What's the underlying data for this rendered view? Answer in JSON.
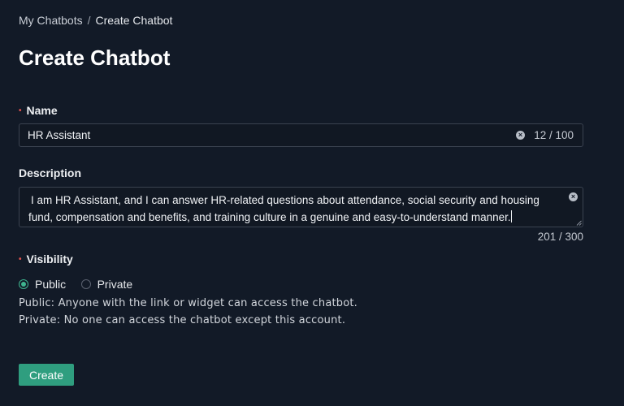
{
  "breadcrumb": {
    "parent": "My Chatbots",
    "separator": "/",
    "current": "Create Chatbot"
  },
  "page_title": "Create Chatbot",
  "form": {
    "name": {
      "label": "Name",
      "value": "HR Assistant",
      "counter": "12 / 100"
    },
    "description": {
      "label": "Description",
      "value": "I am HR Assistant, and I can answer HR-related questions about attendance, social security and housing fund, compensation and benefits, and training culture in a genuine and easy-to-understand manner.",
      "counter": "201 / 300"
    },
    "visibility": {
      "label": "Visibility",
      "options": [
        {
          "label": "Public",
          "checked": true
        },
        {
          "label": "Private",
          "checked": false
        }
      ],
      "help_public": "Public: Anyone with the link or widget can access the chatbot.",
      "help_private": "Private: No one can access the chatbot except this account."
    },
    "submit_label": "Create"
  },
  "colors": {
    "background": "#121a27",
    "accent": "#2f9e7f",
    "required": "#e0524f",
    "radio_checked": "#3fb58f"
  },
  "icons": {
    "clear": "clear-icon",
    "resize": "resize-handle-icon"
  }
}
